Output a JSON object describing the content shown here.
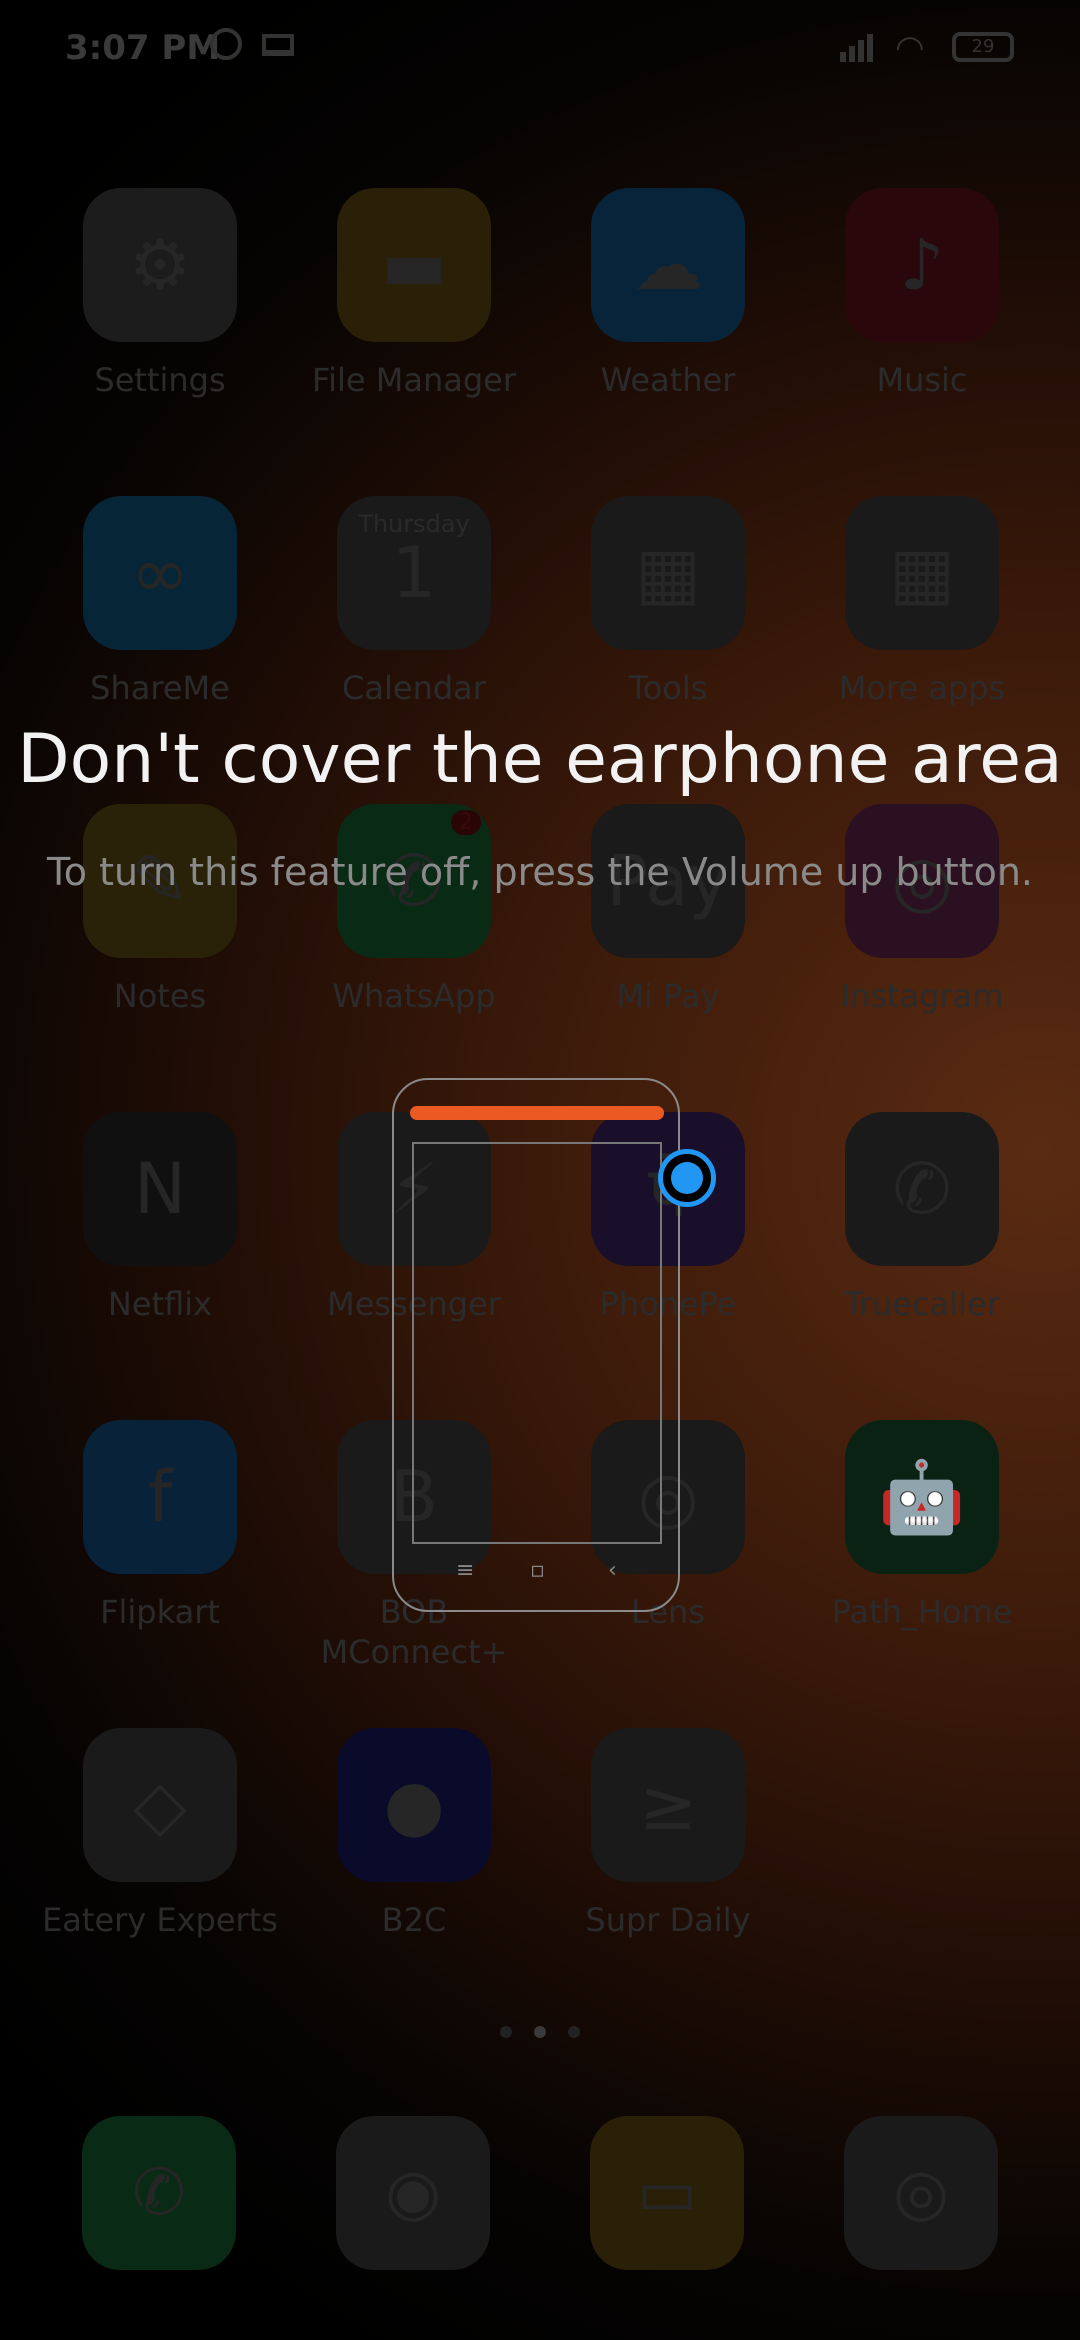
{
  "status_bar": {
    "time": "3:07 PM",
    "battery": "29"
  },
  "home": {
    "rows": [
      [
        {
          "name": "Settings",
          "color": "#1c1c1c",
          "glyph": "⚙"
        },
        {
          "name": "File Manager",
          "color": "#2a2008",
          "glyph": "▬"
        },
        {
          "name": "Weather",
          "color": "#08243a",
          "glyph": "☁"
        },
        {
          "name": "Music",
          "color": "#2a070b",
          "glyph": "♪"
        }
      ],
      [
        {
          "name": "ShareMe",
          "color": "#062638",
          "glyph": "∞"
        },
        {
          "name": "Calendar",
          "color": "#1a1a1a",
          "glyph": "1",
          "sub": "Thursday"
        },
        {
          "name": "Tools",
          "color": "#1a1a1a",
          "glyph": "▦"
        },
        {
          "name": "More apps",
          "color": "#1a1a1a",
          "glyph": "▦"
        }
      ],
      [
        {
          "name": "Notes",
          "color": "#2a2208",
          "glyph": "✎"
        },
        {
          "name": "WhatsApp",
          "color": "#092a14",
          "glyph": "✆",
          "badge": "2"
        },
        {
          "name": "Mi Pay",
          "color": "#1a1a1a",
          "glyph": "Pay"
        },
        {
          "name": "Instagram",
          "color": "#2a1020",
          "glyph": "◎"
        }
      ],
      [
        {
          "name": "Netflix",
          "color": "#101010",
          "glyph": "N"
        },
        {
          "name": "Messenger",
          "color": "#1a1a1a",
          "glyph": "⚡"
        },
        {
          "name": "PhonePe",
          "color": "#1a0f2a",
          "glyph": "पे"
        },
        {
          "name": "Truecaller",
          "color": "#1a1a1a",
          "glyph": "✆"
        }
      ],
      [
        {
          "name": "Flipkart",
          "color": "#08223a",
          "glyph": "f"
        },
        {
          "name": "BOB MConnect+",
          "color": "#1a1a1a",
          "glyph": "B"
        },
        {
          "name": "Lens",
          "color": "#1a1a1a",
          "glyph": "◎"
        },
        {
          "name": "Path_Home",
          "color": "#0a2214",
          "glyph": "🤖"
        }
      ],
      [
        {
          "name": "Eatery Experts",
          "color": "#1a1a1a",
          "glyph": "◇"
        },
        {
          "name": "B2C",
          "color": "#0a0a2a",
          "glyph": "●"
        },
        {
          "name": "Supr Daily",
          "color": "#1a1a1a",
          "glyph": "≥"
        }
      ]
    ]
  },
  "dialog": {
    "headline": "Don't cover the earphone area",
    "subtext": "To turn this feature off, press the Volume up button."
  },
  "dock": [
    {
      "name": "Phone",
      "color": "#092a14",
      "glyph": "✆"
    },
    {
      "name": "Chrome",
      "color": "#1a1a1a",
      "glyph": "◉"
    },
    {
      "name": "Messaging",
      "color": "#2a2008",
      "glyph": "▭"
    },
    {
      "name": "Camera",
      "color": "#1a1a1a",
      "glyph": "◎"
    }
  ],
  "accent": {
    "earbar": "#ec5a24",
    "finger": "#2196f3"
  }
}
